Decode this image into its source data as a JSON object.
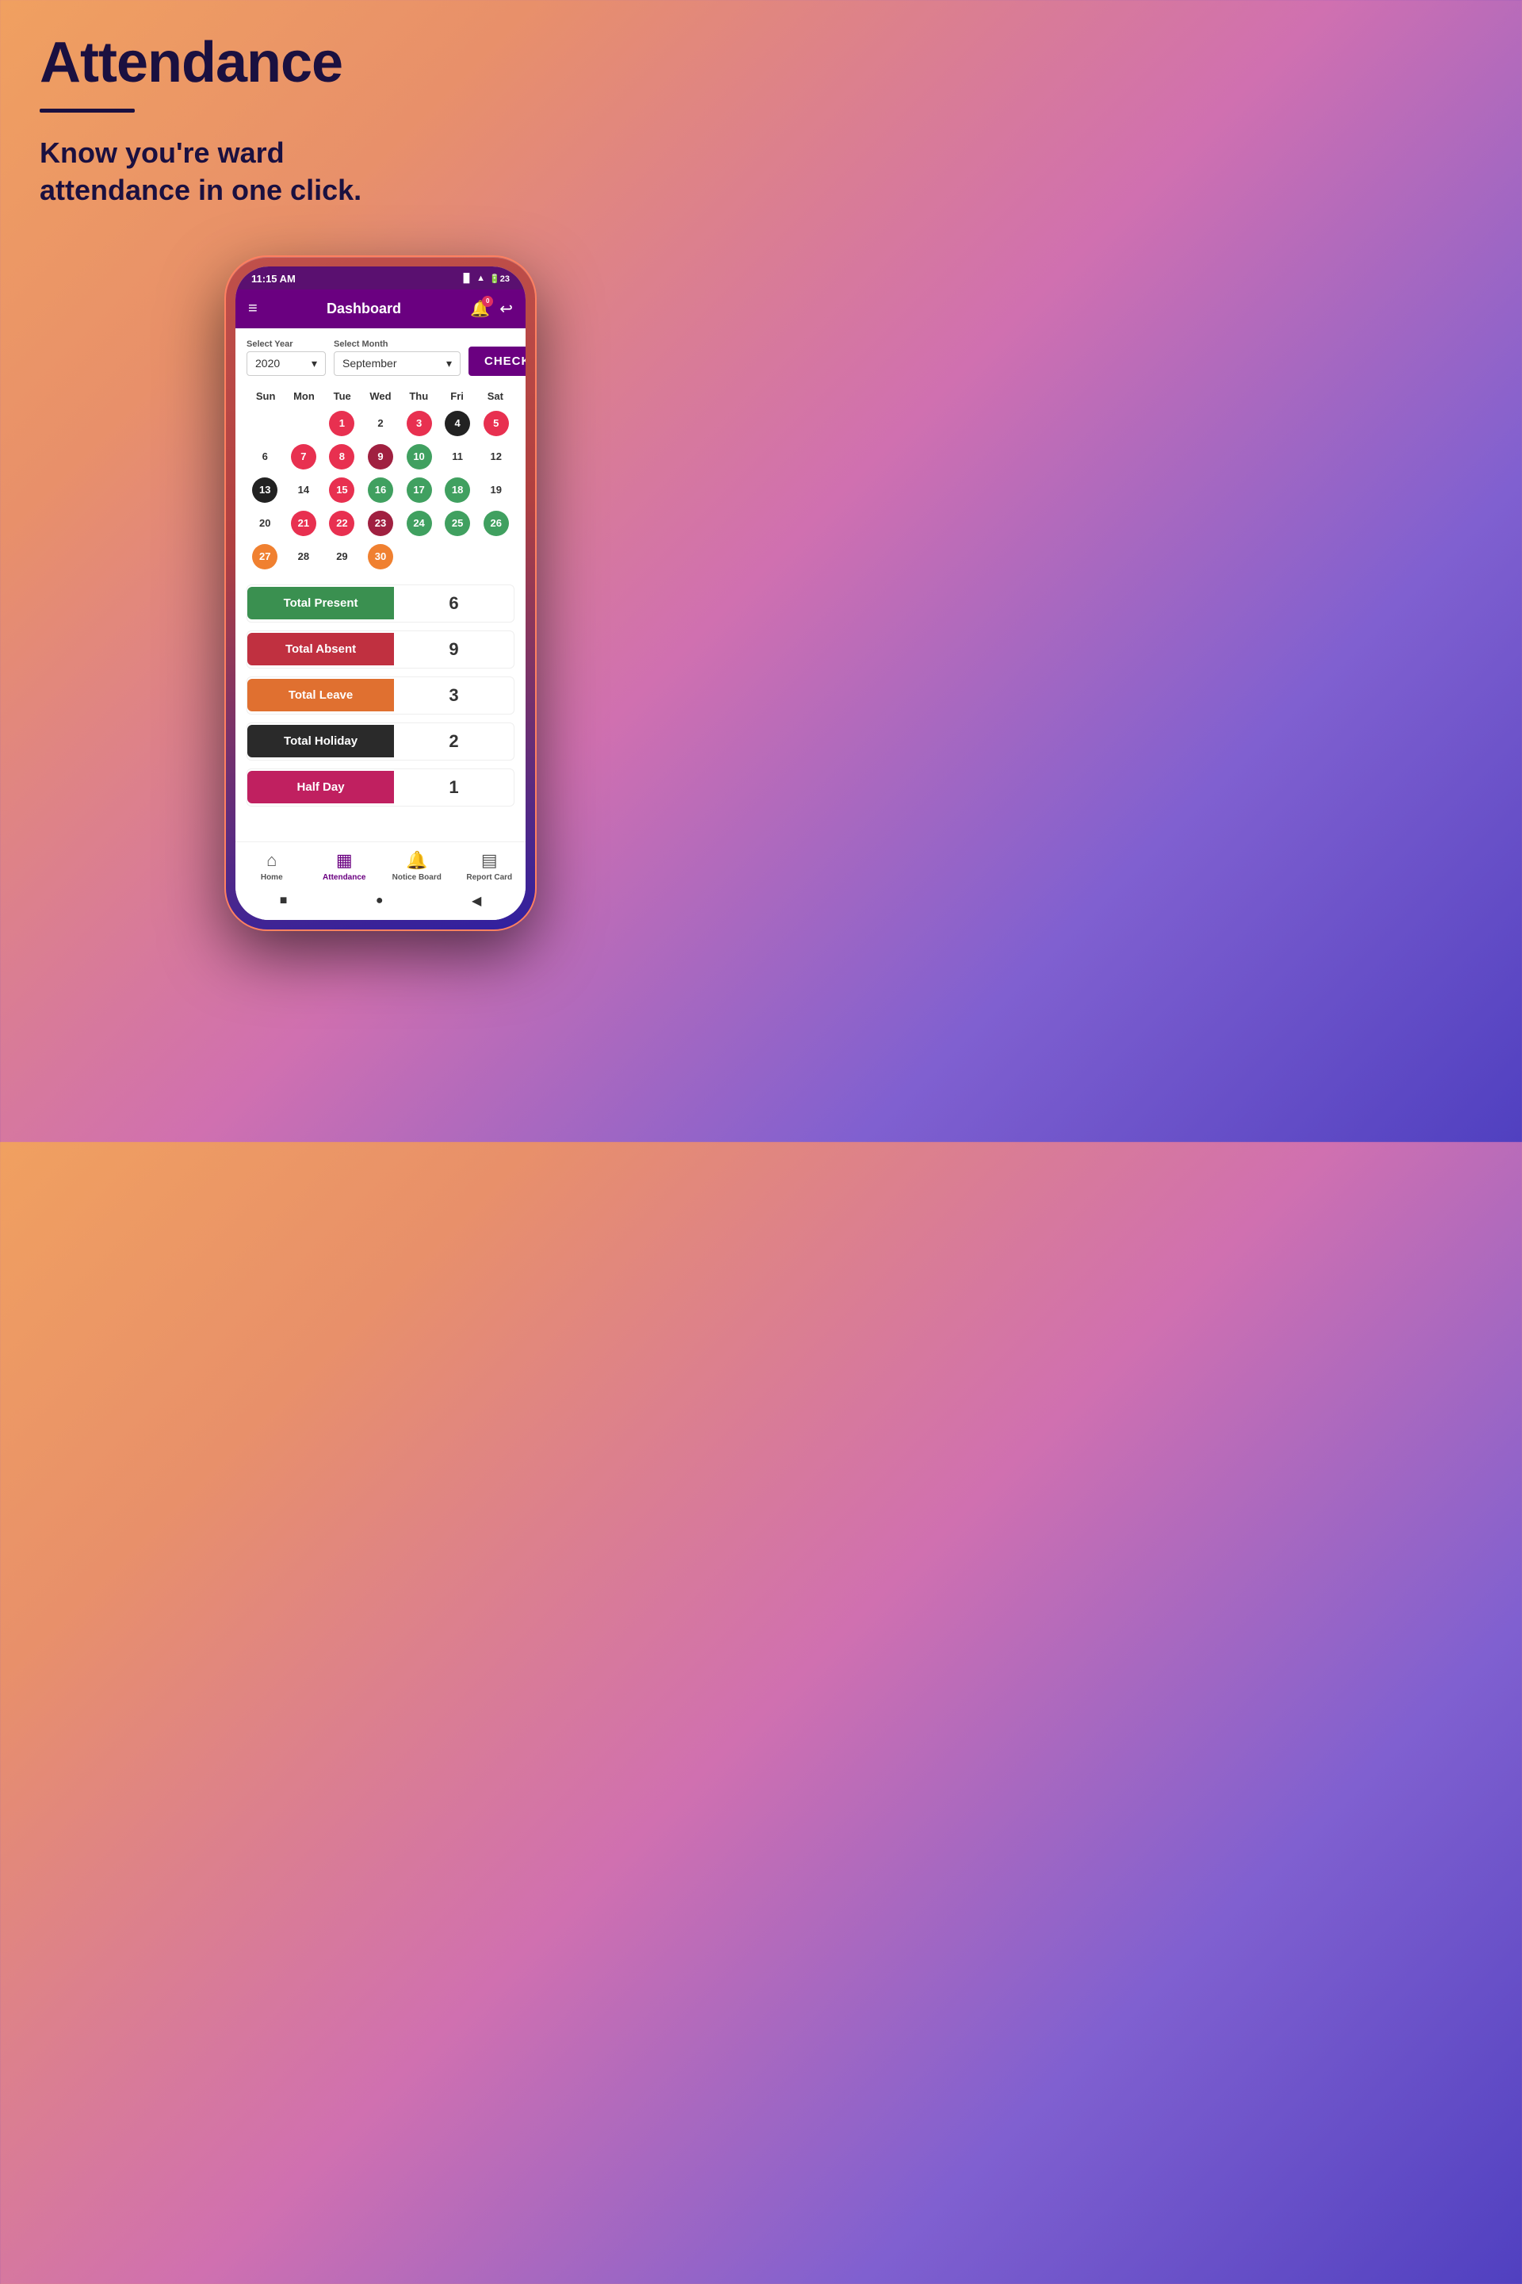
{
  "header": {
    "title": "Attendance",
    "subtitle": "Know you’re ward\nattendance in one click."
  },
  "phone": {
    "status_bar": {
      "time": "11:15 AM",
      "signal": "▐▌▌",
      "wifi": "▲",
      "battery": "23"
    },
    "nav": {
      "title": "Dashboard",
      "notification_count": "0"
    },
    "select_year": {
      "label": "Select Year",
      "value": "2020"
    },
    "select_month": {
      "label": "Select Month",
      "value": "September"
    },
    "check_button": "CHECK",
    "calendar": {
      "day_headers": [
        "Sun",
        "Mon",
        "Tue",
        "Wed",
        "Thu",
        "Fri",
        "Sat"
      ],
      "weeks": [
        [
          {
            "num": "",
            "type": "empty"
          },
          {
            "num": "",
            "type": "empty"
          },
          {
            "num": "1",
            "type": "red"
          },
          {
            "num": "2",
            "type": "plain"
          },
          {
            "num": "3",
            "type": "red"
          },
          {
            "num": "4",
            "type": "dark"
          },
          {
            "num": "5",
            "type": "red"
          }
        ],
        [
          {
            "num": "6",
            "type": "plain"
          },
          {
            "num": "7",
            "type": "red"
          },
          {
            "num": "8",
            "type": "red"
          },
          {
            "num": "9",
            "type": "darkred"
          },
          {
            "num": "10",
            "type": "green"
          },
          {
            "num": "11",
            "type": "plain"
          },
          {
            "num": "12",
            "type": "plain"
          }
        ],
        [
          {
            "num": "13",
            "type": "dark"
          },
          {
            "num": "14",
            "type": "plain"
          },
          {
            "num": "15",
            "type": "red"
          },
          {
            "num": "16",
            "type": "green"
          },
          {
            "num": "17",
            "type": "green"
          },
          {
            "num": "18",
            "type": "green"
          },
          {
            "num": "19",
            "type": "plain"
          }
        ],
        [
          {
            "num": "20",
            "type": "plain"
          },
          {
            "num": "21",
            "type": "red"
          },
          {
            "num": "22",
            "type": "red"
          },
          {
            "num": "23",
            "type": "darkred"
          },
          {
            "num": "24",
            "type": "green"
          },
          {
            "num": "25",
            "type": "green"
          },
          {
            "num": "26",
            "type": "green"
          }
        ],
        [
          {
            "num": "27",
            "type": "orange"
          },
          {
            "num": "28",
            "type": "plain"
          },
          {
            "num": "29",
            "type": "plain"
          },
          {
            "num": "30",
            "type": "orange"
          },
          {
            "num": "",
            "type": "empty"
          },
          {
            "num": "",
            "type": "empty"
          },
          {
            "num": "",
            "type": "empty"
          }
        ]
      ]
    },
    "stats": [
      {
        "label": "Total Present",
        "value": "6",
        "color": "green"
      },
      {
        "label": "Total Absent",
        "value": "9",
        "color": "red"
      },
      {
        "label": "Total Leave",
        "value": "3",
        "color": "orange"
      },
      {
        "label": "Total Holiday",
        "value": "2",
        "color": "dark"
      },
      {
        "label": "Half Day",
        "value": "1",
        "color": "pink"
      }
    ],
    "bottom_nav": [
      {
        "label": "Home",
        "icon": "⌂",
        "active": false
      },
      {
        "label": "Attendance",
        "icon": "▦",
        "active": true
      },
      {
        "label": "Notice Board",
        "icon": "🔔",
        "active": false
      },
      {
        "label": "Report Card",
        "icon": "▤",
        "active": false
      }
    ],
    "android_nav": [
      "■",
      "●",
      "◀"
    ]
  }
}
